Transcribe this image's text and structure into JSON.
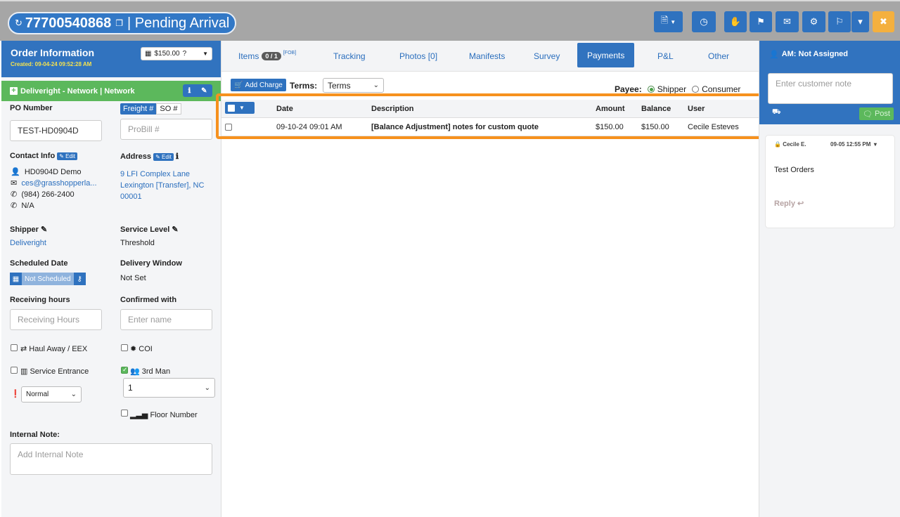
{
  "header": {
    "order_number": "77700540868",
    "status": "| Pending Arrival",
    "buttons": [
      {
        "name": "document-menu-button",
        "icon": "document-icon",
        "glyph": "🗎"
      },
      {
        "name": "history-button",
        "icon": "clock-icon",
        "glyph": "◷"
      },
      {
        "name": "hold-button",
        "icon": "hand-icon",
        "glyph": "✋"
      },
      {
        "name": "flag-button",
        "icon": "flag-icon",
        "glyph": "⚑"
      },
      {
        "name": "email-button",
        "icon": "envelope-icon",
        "glyph": "✉"
      },
      {
        "name": "settings-button",
        "icon": "gear-icon",
        "glyph": "⚙"
      },
      {
        "name": "route-button",
        "icon": "route-flag-icon",
        "glyph": "⚐"
      },
      {
        "name": "route-dropdown-button",
        "icon": "chevron-down-icon",
        "glyph": "▾"
      },
      {
        "name": "close-button",
        "icon": "close-icon",
        "glyph": "✖"
      }
    ]
  },
  "order_info": {
    "title": "Order Information",
    "created": "Created: 09-04-24 09:52:28 AM",
    "price": "$150.00",
    "network": "Deliveright - Network | Network"
  },
  "form": {
    "po_label": "PO Number",
    "po_value": "TEST-HD0904D",
    "freight_btn": "Freight #",
    "so_btn": "SO #",
    "probill_placeholder": "ProBill #",
    "contact_label": "Contact Info",
    "edit_label": "Edit",
    "contact_name": "HD0904D Demo",
    "contact_email": "ces@grasshopperla...",
    "contact_phone": "(984) 266-2400",
    "contact_na": "N/A",
    "address_label": "Address",
    "address_line1": "9 LFI Complex Lane",
    "address_line2": "Lexington [Transfer], NC",
    "address_line3": "00001",
    "shipper_label": "Shipper",
    "shipper_value": "Deliveright",
    "service_label": "Service Level",
    "service_value": "Threshold",
    "scheduled_label": "Scheduled Date",
    "scheduled_value": "Not Scheduled",
    "window_label": "Delivery Window",
    "window_value": "Not Set",
    "receiving_label": "Receiving hours",
    "receiving_placeholder": "Receiving Hours",
    "confirmed_label": "Confirmed with",
    "confirmed_placeholder": "Enter name",
    "haul_away": "Haul Away / EEX",
    "coi": "COI",
    "service_entrance": "Service Entrance",
    "third_man": "3rd Man",
    "third_man_count": "1",
    "priority": "Normal",
    "floor_number": "Floor Number",
    "internal_note_label": "Internal Note:",
    "internal_note_placeholder": "Add Internal Note"
  },
  "tabs": [
    {
      "label": "Items",
      "badge": "0 / 1",
      "sup": "[FOB]"
    },
    {
      "label": "Tracking"
    },
    {
      "label": "Photos [0]"
    },
    {
      "label": "Manifests"
    },
    {
      "label": "Survey"
    },
    {
      "label": "Payments",
      "active": true
    },
    {
      "label": "P&L"
    },
    {
      "label": "Other"
    }
  ],
  "payments": {
    "add_charge": "Add Charge",
    "terms_label": "Terms:",
    "terms_value": "Terms",
    "payee_label": "Payee:",
    "payee_options": [
      "Shipper",
      "Consumer"
    ],
    "payee_selected": "Shipper",
    "columns": [
      "Date",
      "Description",
      "Amount",
      "Balance",
      "User"
    ],
    "rows": [
      {
        "date": "09-10-24 09:01 AM",
        "description": "[Balance Adjustment] notes for custom quote",
        "amount": "$150.00",
        "balance": "$150.00",
        "user": "Cecile Esteves"
      }
    ]
  },
  "sidebar": {
    "am": "AM: Not Assigned",
    "note_placeholder": "Enter customer note",
    "post": "Post",
    "comment": {
      "author": "Cecile E.",
      "time": "09-05 12:55 PM",
      "body": "Test Orders",
      "reply": "Reply"
    }
  },
  "colors": {
    "primary": "#3173bf",
    "success": "#5cb85c",
    "warning": "#f4b03e",
    "highlight": "#f6911e"
  }
}
